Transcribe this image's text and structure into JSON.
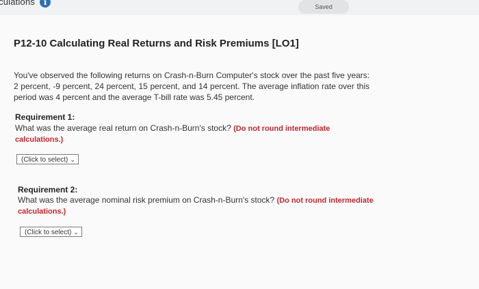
{
  "header": {
    "title": "culations",
    "info_icon": "info-icon",
    "info_glyph": "i",
    "saved_label": "Saved"
  },
  "problem": {
    "title": "P12-10 Calculating Real Returns and Risk Premiums [LO1]",
    "description": "You've observed the following returns on Crash-n-Burn Computer's stock over the past five years: 2 percent, -9 percent, 24 percent, 15 percent, and 14 percent. The average inflation rate over this period was 4 percent and the average T-bill rate was 5.45 percent."
  },
  "requirements": [
    {
      "label": "Requirement 1:",
      "question": "What was the average real return on Crash-n-Burn's stock?",
      "note": "(Do not round intermediate calculations.)",
      "select_value": "(Click to select)"
    },
    {
      "label": "Requirement 2:",
      "question": "What was the average nominal risk premium on Crash-n-Burn's stock?",
      "note": "(Do not round intermediate calculations.)",
      "select_value": "(Click to select)"
    }
  ]
}
